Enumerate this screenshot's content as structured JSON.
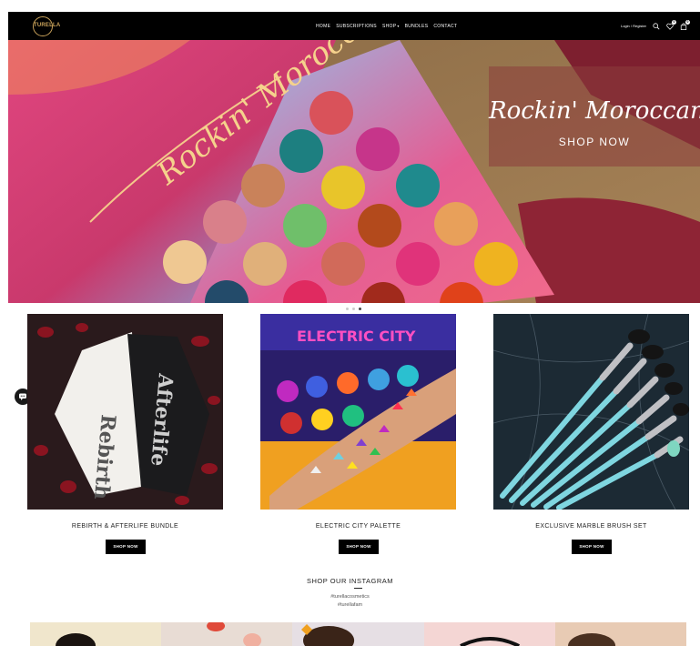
{
  "header": {
    "logo_text": "TURELLA",
    "nav": [
      {
        "label": "HOME",
        "has_dropdown": false
      },
      {
        "label": "SUBSCRIPTIONS",
        "has_dropdown": false
      },
      {
        "label": "SHOP",
        "has_dropdown": true
      },
      {
        "label": "BUNDLES",
        "has_dropdown": false
      },
      {
        "label": "CONTACT",
        "has_dropdown": false
      }
    ],
    "login_label": "Login / Register",
    "wishlist_count": "0",
    "cart_count": "0",
    "icons": [
      "search-icon",
      "heart-icon",
      "bag-icon"
    ]
  },
  "hero": {
    "palette_script": "Rockin' Moroccan",
    "title": "Rockin' Moroccan",
    "cta_label": "SHOP NOW",
    "slides": 3,
    "active_slide": 3
  },
  "products": [
    {
      "name": "REBIRTH & AFTERLIFE BUNDLE",
      "button_label": "SHOP NOW",
      "image_text_1": "Rebirth",
      "image_text_2": "Afterlife"
    },
    {
      "name": "ELECTRIC CITY PALETTE",
      "button_label": "SHOP NOW",
      "image_text_1": "ELECTRIC CITY"
    },
    {
      "name": "EXCLUSIVE MARBLE BRUSH SET",
      "button_label": "SHOP NOW"
    }
  ],
  "instagram": {
    "title": "SHOP OUR INSTAGRAM",
    "hashtags": [
      "#turellacosmetics",
      "#turellafam"
    ]
  },
  "colors": {
    "header_bg": "#000000",
    "logo_gold": "#c9a25a",
    "button_bg": "#000000",
    "hero_panel": "rgba(140,60,60,0.55)"
  }
}
